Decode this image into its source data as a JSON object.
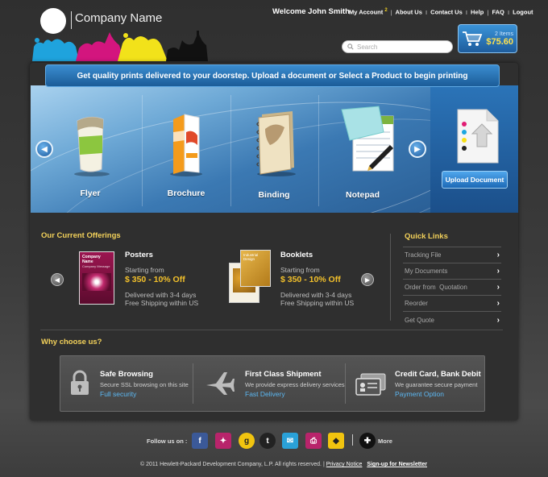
{
  "header": {
    "company_name": "Company Name",
    "welcome": "Welcome John Smith",
    "nav": {
      "my_account": "My Account",
      "account_badge": "2",
      "about": "About Us",
      "contact": "Contact Us",
      "help": "Help",
      "faq": "FAQ",
      "logout": "Logout"
    },
    "search_placeholder": "Search",
    "cart": {
      "items": "2 Items",
      "total": "$75.60"
    }
  },
  "banner": {
    "tagline": "Get quality prints delivered to your doorstep. Upload a document or Select a Product to begin printing",
    "products": [
      "Flyer",
      "Brochure",
      "Binding",
      "Notepad"
    ],
    "upload_label": "Upload Document"
  },
  "offerings": {
    "heading": "Our Current Offerings",
    "items": [
      {
        "title": "Posters",
        "thumb_text": "Company Name",
        "thumb_sub": "Company Message",
        "from": "Starting from",
        "price": "$ 350 - 10% Off",
        "delivery": "Delivered with 3-4 days",
        "shipping": "Free Shipping within US"
      },
      {
        "title": "Booklets",
        "thumb_text": "Industrial Design",
        "from": "Starting from",
        "price": "$ 350 - 10% Off",
        "delivery": "Delivered with 3-4 days",
        "shipping": "Free Shipping within US"
      }
    ]
  },
  "quick_links": {
    "heading": "Quick Links",
    "items": [
      "Tracking File",
      "My Documents",
      "Order from  Quotation",
      "Reorder",
      "Get Quote"
    ]
  },
  "why": {
    "heading": "Why choose us?",
    "items": [
      {
        "title": "Safe Browsing",
        "desc": "Secure SSL browsing  on this site",
        "link": "Full security"
      },
      {
        "title": "First Class Shipment",
        "desc": "We provide express delivery services",
        "link": "Fast Delivery"
      },
      {
        "title": "Credit Card, Bank Debit",
        "desc": "We guarantee secure payment",
        "link": "Payment Option"
      }
    ]
  },
  "footer": {
    "follow": "Follow us on :",
    "social_icons": [
      "facebook-icon",
      "myspace-icon",
      "google-icon",
      "tumblr-icon",
      "email-icon",
      "print-icon",
      "delicious-icon"
    ],
    "more": "More",
    "copyright": "© 2011 Hewlett-Packard Development Company, L.P. All rights reserved.",
    "privacy": "Privacy Notice",
    "newsletter": "Sign-up for Newsletter"
  },
  "colors": {
    "accent_blue": "#1e5c9c",
    "price_yellow": "#f3c12b",
    "heading_yellow": "#f3d15a",
    "link_blue": "#5cb8f3"
  }
}
